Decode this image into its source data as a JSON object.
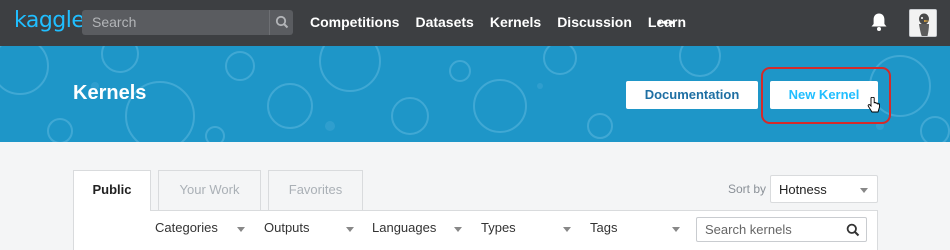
{
  "brand": {
    "logo": "kaggle",
    "accent": "#20beff",
    "nav_bg": "#3d3f42",
    "hero_bg": "#1e96c8"
  },
  "search": {
    "placeholder": "Search"
  },
  "nav": {
    "items": [
      "Competitions",
      "Datasets",
      "Kernels",
      "Discussion",
      "Learn"
    ],
    "more": "•••"
  },
  "hero": {
    "title": "Kernels",
    "documentation_label": "Documentation",
    "new_kernel_label": "New Kernel"
  },
  "tabs": [
    {
      "label": "Public",
      "active": true
    },
    {
      "label": "Your Work",
      "active": false
    },
    {
      "label": "Favorites",
      "active": false
    }
  ],
  "sort": {
    "label": "Sort by",
    "value": "Hotness"
  },
  "filters": [
    "Categories",
    "Outputs",
    "Languages",
    "Types",
    "Tags"
  ],
  "kernel_search": {
    "placeholder": "Search kernels"
  },
  "icons": {
    "search": "search-icon",
    "bell": "bell-icon",
    "avatar": "avatar",
    "cursor": "hand-pointer-icon"
  }
}
